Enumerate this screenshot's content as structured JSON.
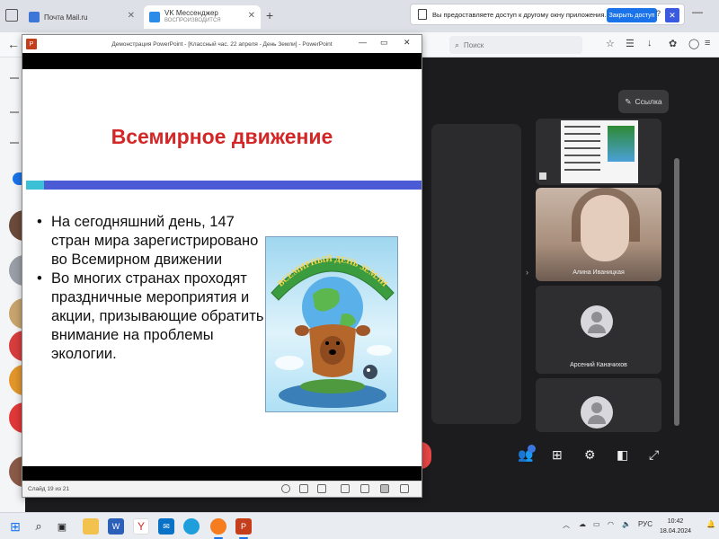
{
  "browser": {
    "tabs": [
      {
        "title": "Почта Mail.ru",
        "subtitle": ""
      },
      {
        "title": "VK Мессенджер",
        "subtitle": "ВОСПРОИЗВОДИТСЯ"
      }
    ],
    "new_tab_symbol": "+",
    "close_symbol": "✕",
    "notice_text": "Вы предоставляете доступ к другому окну приложения.",
    "notice_button": "Закрыть доступ",
    "notice_close": "✕",
    "search_placeholder": "Поиск"
  },
  "powerpoint": {
    "window_title": "Демонстрация PowerPoint - [Классный час. 22 апреля - День Земли] - PowerPoint",
    "app_letter": "P",
    "slide": {
      "title": "Всемирное движение",
      "bullets": [
        "На сегодняшний день, 147 стран мира зарегистрировано во Всемирном движении",
        "Во многих странах проходят праздничные мероприятия и акции, призывающие обратить внимание на проблемы экологии."
      ],
      "image_banner_text": "ВСЕМИРНЫЙ ДЕНЬ ЗЕМЛИ"
    },
    "status": {
      "slide_counter": "Слайд 19 из 21"
    }
  },
  "call": {
    "link_button": "Ссылка",
    "participants": [
      {
        "name": ""
      },
      {
        "name": "Алина Иваницкая"
      },
      {
        "name": "Арсений Каначихов"
      },
      {
        "name": ""
      }
    ]
  },
  "taskbar": {
    "language": "РУС",
    "time": "10:42",
    "date": "18.04.2024"
  },
  "colors": {
    "slide_title": "#d32727",
    "slide_rule": "#4b5bd6",
    "accent_blue": "#1a73e8",
    "call_background": "#1c1c1e"
  }
}
